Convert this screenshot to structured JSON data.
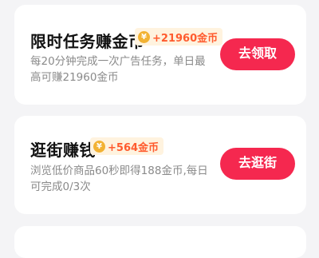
{
  "tasks": [
    {
      "title": "限时任务赚金币",
      "reward": "+21960金币",
      "coin_symbol": "¥",
      "description": "每20分钟完成一次广告任务，单日最高可赚21960金币",
      "button_label": "去领取"
    },
    {
      "title": "逛街赚钱",
      "reward": "+564金币",
      "coin_symbol": "¥",
      "description": "浏览低价商品60秒即得188金币,每日可完成0/3次",
      "button_label": "去逛街"
    }
  ],
  "colors": {
    "accent": "#f5284f",
    "reward_text": "#ff5b2e",
    "coin": "#f2b233",
    "badge_bg": "#fff3df",
    "page_bg": "#f4f4f6"
  },
  "icons": [
    "coin-icon"
  ]
}
